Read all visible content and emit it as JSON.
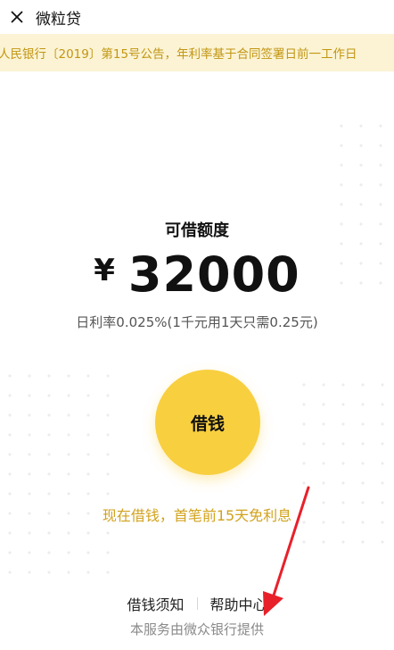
{
  "header": {
    "title": "微粒贷"
  },
  "notice": {
    "text": "人民银行〔2019〕第15号公告，年利率基于合同签署日前一工作日"
  },
  "quota": {
    "label": "可借额度",
    "currency": "¥",
    "amount": "32000",
    "rate_text": "日利率0.025%(1千元用1天只需0.25元)"
  },
  "borrow_button": {
    "label": "借钱"
  },
  "promo": {
    "text": "现在借钱，首笔前15天免利息"
  },
  "links": {
    "notice_label": "借钱须知",
    "help_label": "帮助中心"
  },
  "footer": {
    "text": "本服务由微众银行提供"
  },
  "colors": {
    "accent": "#f8cf3f",
    "notice_bg": "#fbf3d4",
    "notice_text": "#c29613",
    "promo_text": "#d1a21c",
    "arrow": "#e8202a"
  },
  "icons": {
    "close": "close-icon",
    "annotation": "red-arrow-icon"
  }
}
